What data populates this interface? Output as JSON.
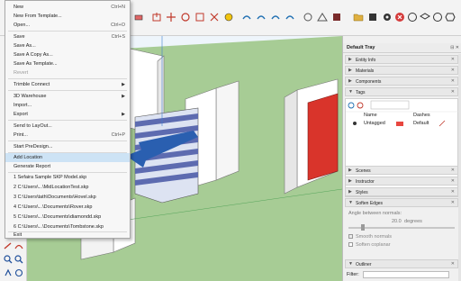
{
  "menu": {
    "items": [
      {
        "label": "New",
        "shortcut": "Ctrl+N"
      },
      {
        "label": "New From Template...",
        "shortcut": ""
      },
      {
        "label": "Open...",
        "shortcut": "Ctrl+O"
      },
      {
        "label": "Save",
        "shortcut": "Ctrl+S"
      },
      {
        "label": "Save As...",
        "shortcut": ""
      },
      {
        "label": "Save A Copy As...",
        "shortcut": ""
      },
      {
        "label": "Save As Template...",
        "shortcut": ""
      },
      {
        "label": "Revert",
        "shortcut": ""
      },
      {
        "label": "Trimble Connect",
        "shortcut": ""
      },
      {
        "label": "3D Warehouse",
        "shortcut": ""
      },
      {
        "label": "Import...",
        "shortcut": ""
      },
      {
        "label": "Export",
        "shortcut": ""
      },
      {
        "label": "Send to LayOut...",
        "shortcut": ""
      },
      {
        "label": "Print...",
        "shortcut": "Ctrl+P"
      },
      {
        "label": "Start PreDesign...",
        "shortcut": ""
      },
      {
        "label": "Add Location",
        "shortcut": ""
      },
      {
        "label": "Generate Report",
        "shortcut": ""
      },
      {
        "label": "1 Sefaira Sample SKP Model.skp",
        "shortcut": ""
      },
      {
        "label": "2 C:\\Users\\...\\MidLocationTest.skp",
        "shortcut": ""
      },
      {
        "label": "3 C:\\Users\\tath\\Documents\\Hovel.skp",
        "shortcut": ""
      },
      {
        "label": "4 C:\\Users\\...\\Documents\\Rover.skp",
        "shortcut": ""
      },
      {
        "label": "5 C:\\Users\\...\\Documents\\diamondd.skp",
        "shortcut": ""
      },
      {
        "label": "6 C:\\Users\\...\\Documents\\Tombstone.skp",
        "shortcut": ""
      },
      {
        "label": "Exit",
        "shortcut": ""
      }
    ],
    "highlighted": "Add Location"
  },
  "tray": {
    "title": "Default Tray",
    "panels": {
      "entity_info": "Entity Info",
      "materials": "Materials",
      "components": "Components",
      "tags": "Tags",
      "scenes": "Scenes",
      "instructor": "Instructor",
      "styles": "Styles",
      "soften_edges": "Soften Edges",
      "outliner": "Outliner"
    },
    "tags": {
      "col_name": "Name",
      "col_dashes": "Dashes",
      "row_name": "Untagged",
      "row_dashes": "Default",
      "row_color": "#e8463f"
    },
    "soften": {
      "angle_label": "Angle between normals:",
      "angle_value": "20.0",
      "angle_unit": "degrees",
      "smooth_normals": "Smooth normals",
      "soften_coplanar": "Soften coplanar"
    },
    "filter_label": "Filter:"
  },
  "colors": {
    "ground": "#a7cc95",
    "sky": "#eef5fb",
    "arrow": "#2a5fb0",
    "accent": "#cde3f5"
  }
}
